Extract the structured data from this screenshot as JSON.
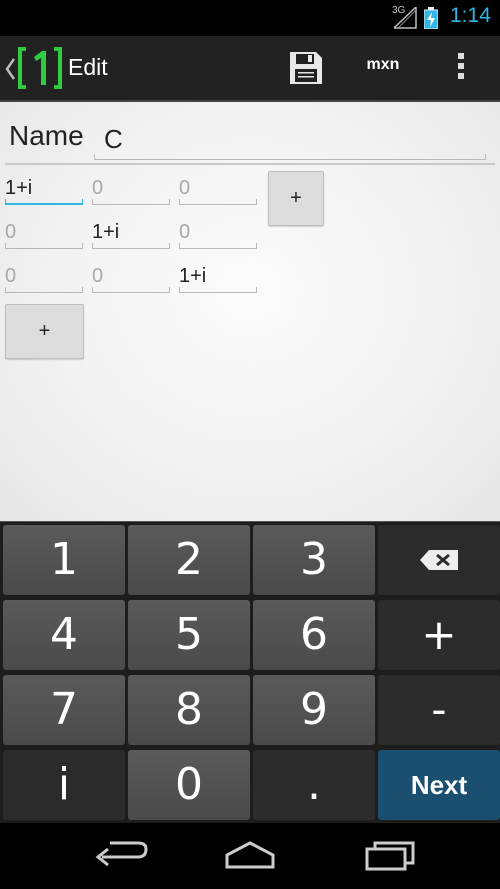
{
  "status_bar": {
    "network": "3G",
    "time": "1:14",
    "icons": [
      "signal-icon",
      "battery-charging-icon"
    ]
  },
  "action_bar": {
    "logo_text": "[1]",
    "title": "Edit",
    "save_icon": "floppy-disk-icon",
    "mode_label": "mxn",
    "overflow_icon": "overflow-menu-icon"
  },
  "form": {
    "name_label": "Name",
    "name_value": "C",
    "matrix": [
      [
        "1+i",
        "0",
        "0"
      ],
      [
        "0",
        "1+i",
        "0"
      ],
      [
        "0",
        "0",
        "1+i"
      ]
    ],
    "add_column_label": "+",
    "add_row_label": "+"
  },
  "keyboard": {
    "rows": [
      [
        "1",
        "2",
        "3",
        "⌫"
      ],
      [
        "4",
        "5",
        "6",
        "+"
      ],
      [
        "7",
        "8",
        "9",
        "-"
      ],
      [
        "i",
        "0",
        ".",
        "Next"
      ]
    ]
  },
  "nav_bar": {
    "icons": [
      "back-icon",
      "home-icon",
      "recent-apps-icon"
    ]
  },
  "colors": {
    "accent": "#33b5e5",
    "logo_green": "#2ecc40",
    "next_key": "#1b4f6f"
  }
}
